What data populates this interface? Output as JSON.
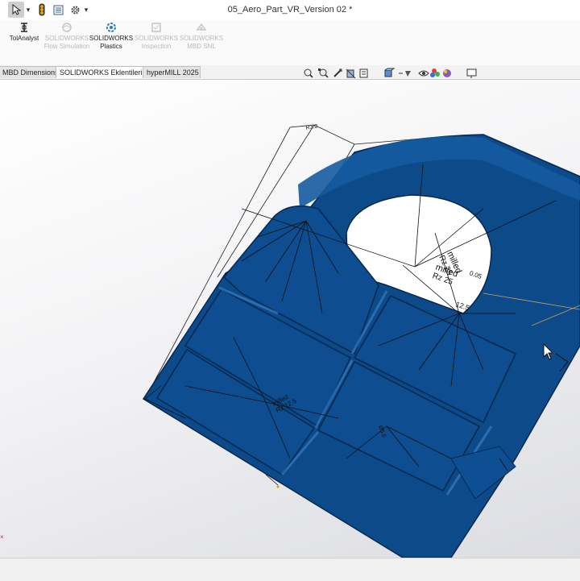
{
  "window": {
    "title": "05_Aero_Part_VR_Version 02 *"
  },
  "quick_access": {
    "select_arrow": "▾",
    "options_arrow": "▾"
  },
  "ribbon": {
    "items": [
      {
        "label": "TolAnalyst",
        "enabled": true
      },
      {
        "label": "SOLIDWORKS Flow Simulation",
        "enabled": false
      },
      {
        "label": "SOLIDWORKS Plastics",
        "enabled": true
      },
      {
        "label": "SOLIDWORKS Inspection",
        "enabled": false
      },
      {
        "label": "SOLIDWORKS MBD SNL",
        "enabled": false
      }
    ]
  },
  "command_tabs": [
    {
      "label": "MBD Dimensions",
      "active": false
    },
    {
      "label": "SOLIDWORKS Eklentileri",
      "active": true
    },
    {
      "label": "hyperMILL 2025",
      "active": false
    }
  ],
  "heads_up_toolbar": {
    "icons": [
      "zoom-to-fit-icon",
      "zoom-to-area-icon",
      "previous-view-icon",
      "section-view-icon",
      "dynamic-annotation-icon",
      "view-orientation-icon",
      "display-style-icon",
      "hide-show-items-icon",
      "edit-appearance-icon",
      "apply-scene-icon",
      "view-settings-icon"
    ]
  },
  "annotations": {
    "upper_surface_finish": [
      "milled",
      "Rz 25",
      "0.05",
      "12.5"
    ],
    "lower_surface_finish": [
      "milled",
      "Rz 12.5"
    ],
    "dimension_small_1": "Ø5.0",
    "dimension_small_2": "R3.0"
  },
  "colors": {
    "part_body": "#0c4a8a",
    "part_edge": "#06284d",
    "annotation_line": "#1a1a1a",
    "selected_annotation": "#c8a060"
  }
}
